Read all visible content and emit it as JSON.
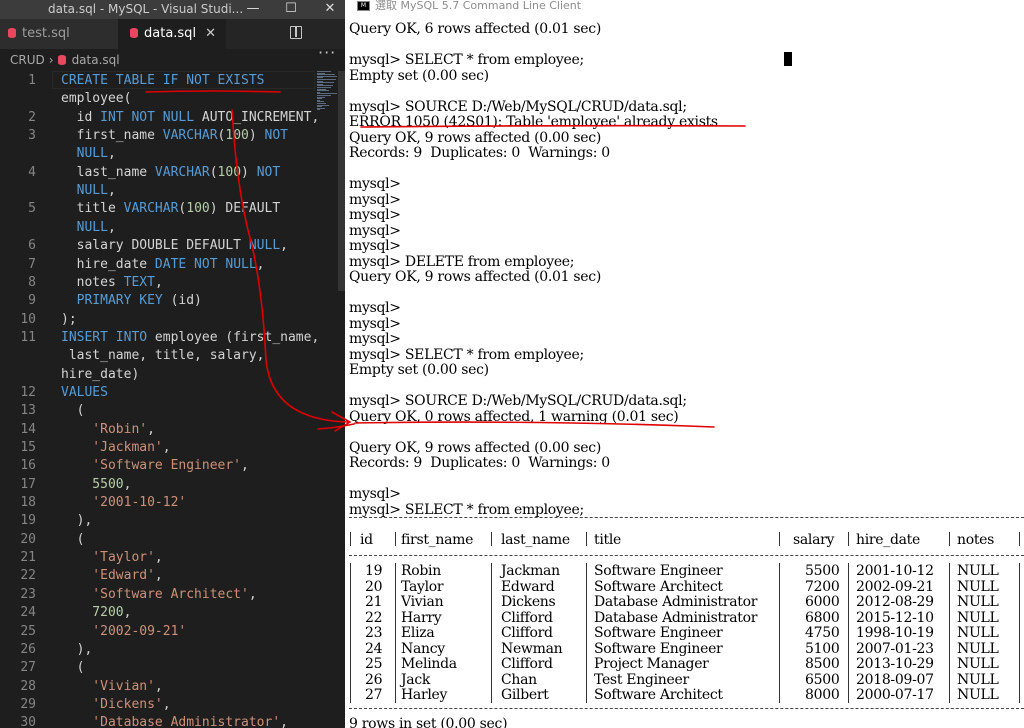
{
  "vscode": {
    "window_title": "data.sql - MySQL - Visual Studi...",
    "controls": {
      "minimize": "—",
      "maximize": "☐",
      "close": "✕"
    },
    "tabs": [
      {
        "label": "test.sql",
        "active": false
      },
      {
        "label": "data.sql",
        "active": true,
        "close": "✕"
      }
    ],
    "more": "···",
    "breadcrumb": [
      "CRUD",
      "data.sql"
    ],
    "breadcrumb_sep": "›",
    "code_lines": [
      {
        "n": "1",
        "segs": [
          [
            "kw",
            "CREATE TABLE IF NOT EXISTS"
          ]
        ]
      },
      {
        "n": "",
        "segs": [
          [
            "t",
            "employee("
          ]
        ]
      },
      {
        "n": "2",
        "segs": [
          [
            "t",
            "  id "
          ],
          [
            "kw",
            "INT NOT NULL"
          ],
          [
            "t",
            " AUTO_INCREMENT,"
          ]
        ]
      },
      {
        "n": "3",
        "segs": [
          [
            "t",
            "  first_name "
          ],
          [
            "kw",
            "VARCHAR"
          ],
          [
            "t",
            "("
          ],
          [
            "num",
            "100"
          ],
          [
            "t",
            ") "
          ],
          [
            "kw",
            "NOT"
          ]
        ]
      },
      {
        "n": "",
        "segs": [
          [
            "kw",
            "  NULL"
          ],
          [
            "t",
            ","
          ]
        ]
      },
      {
        "n": "4",
        "segs": [
          [
            "t",
            "  last_name "
          ],
          [
            "kw",
            "VARCHAR"
          ],
          [
            "t",
            "("
          ],
          [
            "num",
            "100"
          ],
          [
            "t",
            ") "
          ],
          [
            "kw",
            "NOT"
          ]
        ]
      },
      {
        "n": "",
        "segs": [
          [
            "kw",
            "  NULL"
          ],
          [
            "t",
            ","
          ]
        ]
      },
      {
        "n": "5",
        "segs": [
          [
            "t",
            "  title "
          ],
          [
            "kw",
            "VARCHAR"
          ],
          [
            "t",
            "("
          ],
          [
            "num",
            "100"
          ],
          [
            "t",
            ") DEFAULT"
          ]
        ]
      },
      {
        "n": "",
        "segs": [
          [
            "kw",
            "  NULL"
          ],
          [
            "t",
            ","
          ]
        ]
      },
      {
        "n": "6",
        "segs": [
          [
            "t",
            "  salary DOUBLE DEFAULT "
          ],
          [
            "kw",
            "NULL"
          ],
          [
            "t",
            ","
          ]
        ]
      },
      {
        "n": "7",
        "segs": [
          [
            "t",
            "  hire_date "
          ],
          [
            "kw",
            "DATE NOT NULL"
          ],
          [
            "t",
            ","
          ]
        ]
      },
      {
        "n": "8",
        "segs": [
          [
            "t",
            "  notes "
          ],
          [
            "kw",
            "TEXT"
          ],
          [
            "t",
            ","
          ]
        ]
      },
      {
        "n": "9",
        "segs": [
          [
            "kw",
            "  PRIMARY KEY"
          ],
          [
            "t",
            " (id)"
          ]
        ]
      },
      {
        "n": "10",
        "segs": [
          [
            "t",
            ");"
          ]
        ]
      },
      {
        "n": "11",
        "segs": [
          [
            "kw",
            "INSERT INTO"
          ],
          [
            "t",
            " employee (first_name,"
          ]
        ]
      },
      {
        "n": "",
        "segs": [
          [
            "t",
            " last_name, title, salary,"
          ]
        ]
      },
      {
        "n": "",
        "segs": [
          [
            "t",
            "hire_date)"
          ]
        ]
      },
      {
        "n": "12",
        "segs": [
          [
            "kw",
            "VALUES"
          ]
        ]
      },
      {
        "n": "13",
        "segs": [
          [
            "t",
            "  ("
          ]
        ]
      },
      {
        "n": "14",
        "segs": [
          [
            "str",
            "    'Robin'"
          ],
          [
            "t",
            ","
          ]
        ]
      },
      {
        "n": "15",
        "segs": [
          [
            "str",
            "    'Jackman'"
          ],
          [
            "t",
            ","
          ]
        ]
      },
      {
        "n": "16",
        "segs": [
          [
            "str",
            "    'Software Engineer'"
          ],
          [
            "t",
            ","
          ]
        ]
      },
      {
        "n": "17",
        "segs": [
          [
            "num",
            "    5500"
          ],
          [
            "t",
            ","
          ]
        ]
      },
      {
        "n": "18",
        "segs": [
          [
            "str",
            "    '2001-10-12'"
          ]
        ]
      },
      {
        "n": "19",
        "segs": [
          [
            "t",
            "  ),"
          ]
        ]
      },
      {
        "n": "20",
        "segs": [
          [
            "t",
            "  ("
          ]
        ]
      },
      {
        "n": "21",
        "segs": [
          [
            "str",
            "    'Taylor'"
          ],
          [
            "t",
            ","
          ]
        ]
      },
      {
        "n": "22",
        "segs": [
          [
            "str",
            "    'Edward'"
          ],
          [
            "t",
            ","
          ]
        ]
      },
      {
        "n": "23",
        "segs": [
          [
            "str",
            "    'Software Architect'"
          ],
          [
            "t",
            ","
          ]
        ]
      },
      {
        "n": "24",
        "segs": [
          [
            "num",
            "    7200"
          ],
          [
            "t",
            ","
          ]
        ]
      },
      {
        "n": "25",
        "segs": [
          [
            "str",
            "    '2002-09-21'"
          ]
        ]
      },
      {
        "n": "26",
        "segs": [
          [
            "t",
            "  ),"
          ]
        ]
      },
      {
        "n": "27",
        "segs": [
          [
            "t",
            "  ("
          ]
        ]
      },
      {
        "n": "28",
        "segs": [
          [
            "str",
            "    'Vivian'"
          ],
          [
            "t",
            ","
          ]
        ]
      },
      {
        "n": "29",
        "segs": [
          [
            "str",
            "    'Dickens'"
          ],
          [
            "t",
            ","
          ]
        ]
      },
      {
        "n": "30",
        "segs": [
          [
            "str",
            "    'Database Administrator'"
          ],
          [
            "t",
            ","
          ]
        ]
      }
    ],
    "colors": {
      "keyword": "#569cd6",
      "string": "#ce9178",
      "number": "#b5cea8",
      "text": "#d4d4d4",
      "bg": "#1e1e1e"
    }
  },
  "console": {
    "window_title": "選取 MySQL 5.7 Command Line Client",
    "lines": [
      "Query OK, 6 rows affected (0.01 sec)",
      "",
      "mysql> SELECT * from employee;",
      "Empty set (0.00 sec)",
      "",
      "mysql> SOURCE D:/Web/MySQL/CRUD/data.sql;",
      "ERROR 1050 (42S01): Table 'employee' already exists",
      "Query OK, 9 rows affected (0.00 sec)",
      "Records: 9  Duplicates: 0  Warnings: 0",
      "",
      "mysql>",
      "mysql>",
      "mysql>",
      "mysql>",
      "mysql>",
      "mysql> DELETE from employee;",
      "Query OK, 9 rows affected (0.01 sec)",
      "",
      "mysql>",
      "mysql>",
      "mysql>",
      "mysql> SELECT * from employee;",
      "Empty set (0.00 sec)",
      "",
      "mysql> SOURCE D:/Web/MySQL/CRUD/data.sql;",
      "Query OK, 0 rows affected, 1 warning (0.01 sec)",
      "",
      "Query OK, 9 rows affected (0.00 sec)",
      "Records: 9  Duplicates: 0  Warnings: 0",
      "",
      "mysql>",
      "mysql> SELECT * from employee;"
    ],
    "table": {
      "border_line": "+----+------------+----------+------------------------+--------+------------+-------+",
      "columns": [
        "id",
        "first_name",
        "last_name",
        "title",
        "salary",
        "hire_date",
        "notes"
      ],
      "rows": [
        [
          "19",
          "Robin",
          "Jackman",
          "Software Engineer",
          "5500",
          "2001-10-12",
          "NULL"
        ],
        [
          "20",
          "Taylor",
          "Edward",
          "Software Architect",
          "7200",
          "2002-09-21",
          "NULL"
        ],
        [
          "21",
          "Vivian",
          "Dickens",
          "Database Administrator",
          "6000",
          "2012-08-29",
          "NULL"
        ],
        [
          "22",
          "Harry",
          "Clifford",
          "Database Administrator",
          "6800",
          "2015-12-10",
          "NULL"
        ],
        [
          "23",
          "Eliza",
          "Clifford",
          "Software Engineer",
          "4750",
          "1998-10-19",
          "NULL"
        ],
        [
          "24",
          "Nancy",
          "Newman",
          "Software Engineer",
          "5100",
          "2007-01-23",
          "NULL"
        ],
        [
          "25",
          "Melinda",
          "Clifford",
          "Project Manager",
          "8500",
          "2013-10-29",
          "NULL"
        ],
        [
          "26",
          "Jack",
          "Chan",
          "Test Engineer",
          "6500",
          "2018-09-07",
          "NULL"
        ],
        [
          "27",
          "Harley",
          "Gilbert",
          "Software Architect",
          "8000",
          "2000-07-17",
          "NULL"
        ]
      ]
    },
    "footer": "9 rows in set (0.00 sec)"
  },
  "annotation_color": "#e00000"
}
